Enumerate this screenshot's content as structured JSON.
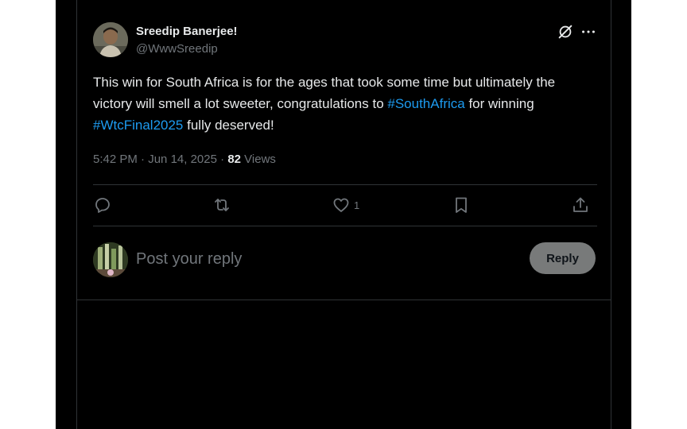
{
  "tweet": {
    "author": {
      "name": "Sreedip Banerjee!",
      "handle": "@WwwSreedip"
    },
    "text": {
      "part1": "This win for South Africa is for the ages that took some time but ultimately the victory will smell a lot sweeter, congratulations to ",
      "hashtag1": "#SouthAfrica",
      "part2": " for winning ",
      "hashtag2": "#WtcFinal2025",
      "part3": " fully deserved!"
    },
    "meta": {
      "time": "5:42 PM",
      "separator": " · ",
      "date": "Jun 14, 2025",
      "views_count": "82",
      "views_label": " Views"
    },
    "actions": {
      "reply": {
        "icon": "reply-icon"
      },
      "repost": {
        "icon": "repost-icon"
      },
      "like": {
        "icon": "heart-icon",
        "count": "1"
      },
      "bookmark": {
        "icon": "bookmark-icon"
      },
      "share": {
        "icon": "share-icon"
      }
    },
    "top_icons": [
      "grok-icon",
      "more-icon"
    ]
  },
  "reply_box": {
    "placeholder": "Post your reply",
    "button_label": "Reply"
  },
  "colors": {
    "background": "#000000",
    "text": "#e7e9ea",
    "muted": "#71767b",
    "link": "#1d9bf0",
    "border": "#2f3336",
    "reply_button": "#787a7a"
  }
}
